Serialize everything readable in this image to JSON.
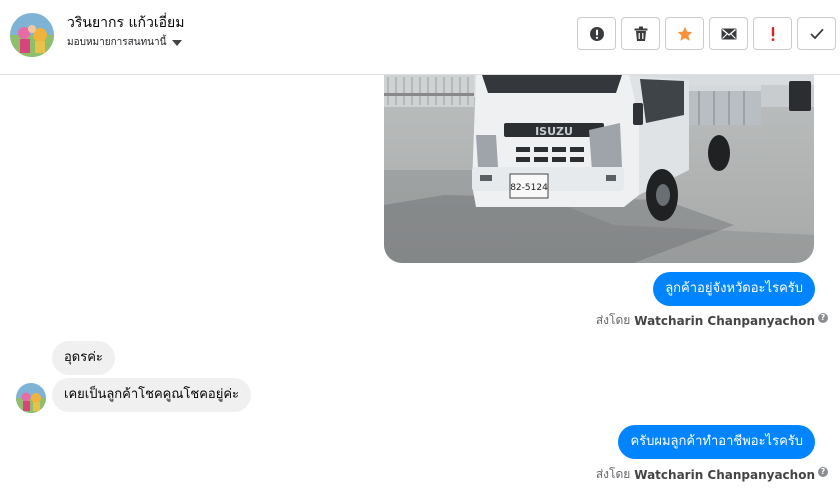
{
  "header": {
    "contact_name": "วรินยากร แก้วเอี่ยม",
    "assign_label": "มอบหมายการสนทนานี้"
  },
  "toolbar": {
    "buttons": [
      {
        "name": "mark-spam",
        "glyph": "!"
      },
      {
        "name": "delete",
        "glyph": ""
      },
      {
        "name": "star",
        "glyph": ""
      },
      {
        "name": "mark-unread",
        "glyph": ""
      },
      {
        "name": "flag-important",
        "glyph": "!"
      },
      {
        "name": "mark-done",
        "glyph": ""
      }
    ]
  },
  "colors": {
    "outgoing_bubble": "#0084ff",
    "incoming_bubble": "#f0f0f0",
    "star": "#f7923a",
    "important": "#e02020"
  },
  "photo": {
    "plate_line1": "82-5124",
    "brand": "ISUZU"
  },
  "messages": [
    {
      "direction": "out",
      "text": "ลูกค้าอยู่จังหวัดอะไรครับ",
      "sent_by_prefix": "ส่งโดย",
      "sent_by_name": "Watcharin Chanpanyachon"
    },
    {
      "direction": "in",
      "text": "อุดรค่ะ"
    },
    {
      "direction": "in",
      "text": "เคยเป็นลูกค้าโชคคูณโชคอยู่ค่ะ"
    },
    {
      "direction": "out",
      "text": "ครับผมลูกค้าทำอาชีพอะไรครับ",
      "sent_by_prefix": "ส่งโดย",
      "sent_by_name": "Watcharin Chanpanyachon"
    }
  ],
  "help_glyph": "?"
}
